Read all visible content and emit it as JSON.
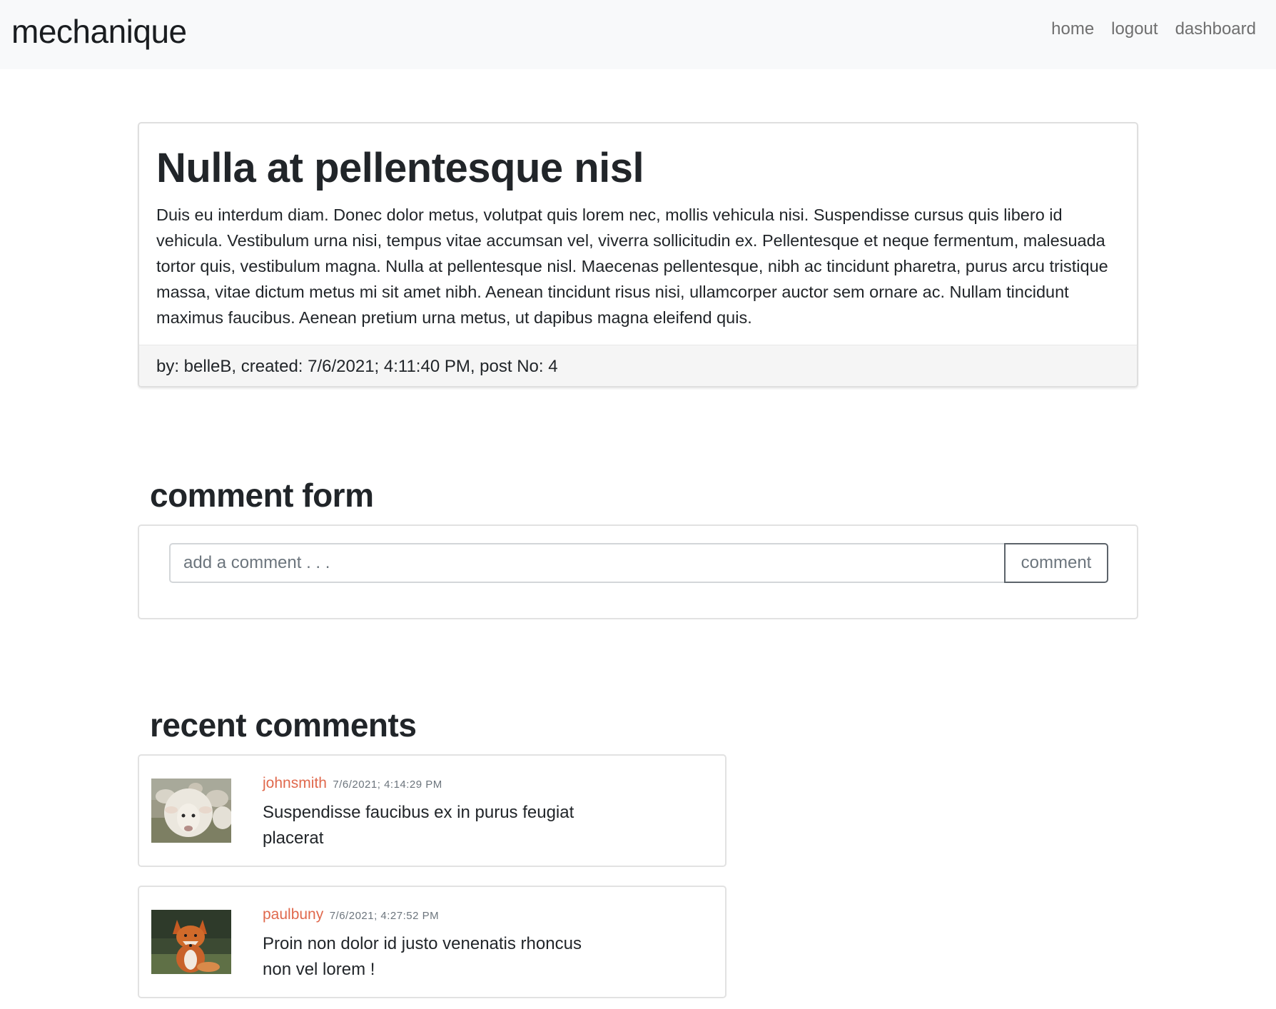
{
  "navbar": {
    "brand": "mechanique",
    "links": [
      "home",
      "logout",
      "dashboard"
    ]
  },
  "post": {
    "title": "Nulla at pellentesque nisl",
    "body": "Duis eu interdum diam. Donec dolor metus, volutpat quis lorem nec, mollis vehicula nisi. Suspendisse cursus quis libero id vehicula. Vestibulum urna nisi, tempus vitae accumsan vel, viverra sollicitudin ex. Pellentesque et neque fermentum, malesuada tortor quis, vestibulum magna. Nulla at pellentesque nisl. Maecenas pellentesque, nibh ac tincidunt pharetra, purus arcu tristique massa, vitae dictum metus mi sit amet nibh. Aenean tincidunt risus nisi, ullamcorper auctor sem ornare ac. Nullam tincidunt maximus faucibus. Aenean pretium urna metus, ut dapibus magna eleifend quis.",
    "footer": "by: belleB, created: 7/6/2021; 4:11:40 PM, post No: 4"
  },
  "comment_form": {
    "heading": "comment form",
    "placeholder": "add a comment . . .",
    "button_label": "comment"
  },
  "recent_comments": {
    "heading": "recent comments",
    "items": [
      {
        "user": "johnsmith",
        "time": "7/6/2021; 4:14:29 PM",
        "text": "Suspendisse faucibus ex in purus feugiat placerat",
        "avatar": "sheep-photo"
      },
      {
        "user": "paulbuny",
        "time": "7/6/2021; 4:27:52 PM",
        "text": "Proin non dolor id justo venenatis rhoncus non vel lorem !",
        "avatar": "fox-photo"
      }
    ]
  },
  "colors": {
    "navbar_bg": "#f8f9fa",
    "username": "#e0694d",
    "footer_bg": "#f5f5f5"
  }
}
